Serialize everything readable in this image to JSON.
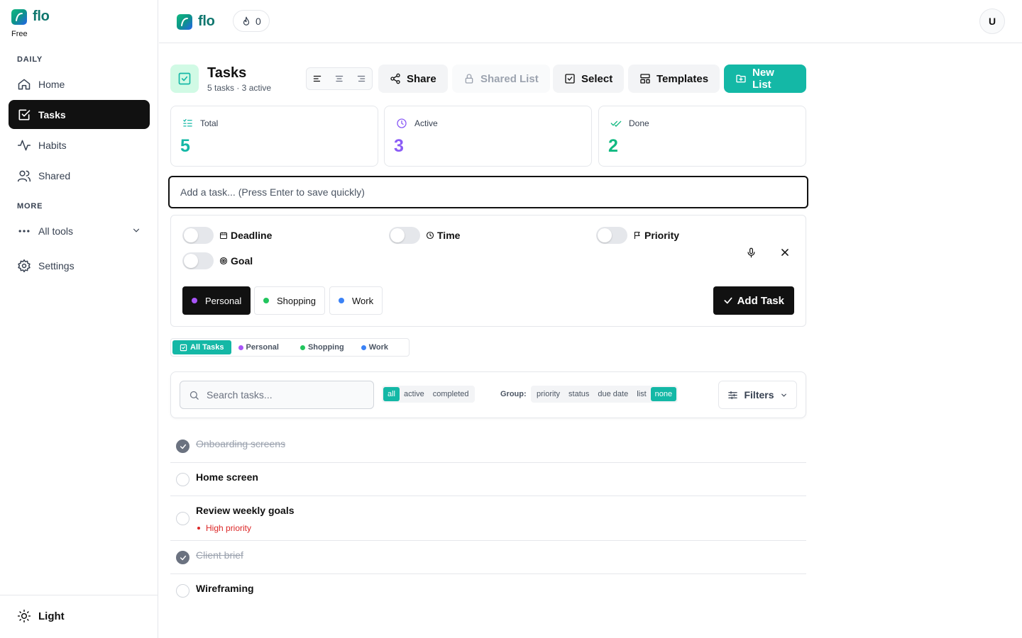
{
  "app": {
    "name": "flo",
    "plan": "Free"
  },
  "sidebar": {
    "section_daily": "DAILY",
    "section_more": "MORE",
    "items": [
      {
        "label": "Home",
        "icon": "home-icon"
      },
      {
        "label": "Tasks",
        "icon": "check-square-icon",
        "active": true
      },
      {
        "label": "Habits",
        "icon": "activity-icon"
      },
      {
        "label": "Shared",
        "icon": "users-icon"
      }
    ],
    "more_items": [
      {
        "label": "All tools",
        "icon": "more-horizontal-icon"
      },
      {
        "label": "Settings",
        "icon": "gear-icon"
      }
    ],
    "theme_label": "Light"
  },
  "topbar": {
    "streak_count": "0",
    "avatar_initial": "U"
  },
  "header": {
    "title": "Tasks",
    "subtitle": "5 tasks · 3 active",
    "buttons": {
      "share": "Share",
      "shared_list": "Shared List",
      "select": "Select",
      "templates": "Templates",
      "new_list": "New List"
    }
  },
  "stats": {
    "total": {
      "label": "Total",
      "value": "5",
      "color": "#14b8a6"
    },
    "active": {
      "label": "Active",
      "value": "3",
      "color": "#8b5cf6"
    },
    "done": {
      "label": "Done",
      "value": "2",
      "color": "#10b981"
    }
  },
  "add_task": {
    "placeholder": "Add a task... (Press Enter to save quickly)",
    "options": {
      "deadline": "Deadline",
      "time": "Time",
      "priority": "Priority",
      "goal": "Goal"
    },
    "lists": [
      {
        "label": "Personal",
        "color": "#a855f7",
        "active": true
      },
      {
        "label": "Shopping",
        "color": "#22c55e"
      },
      {
        "label": "Work",
        "color": "#3b82f6"
      }
    ],
    "submit": "Add Task"
  },
  "list_tabs": [
    {
      "label": "All Tasks",
      "active": true
    },
    {
      "label": "Personal",
      "color": "#a855f7"
    },
    {
      "label": "Shopping",
      "color": "#22c55e"
    },
    {
      "label": "Work",
      "color": "#3b82f6"
    }
  ],
  "filters": {
    "search_placeholder": "Search tasks...",
    "status": [
      "all",
      "active",
      "completed"
    ],
    "status_selected": "all",
    "group_label": "Group:",
    "group": [
      "priority",
      "status",
      "due date",
      "list",
      "none"
    ],
    "group_selected": "none",
    "filters_button": "Filters"
  },
  "tasks": [
    {
      "title": "Onboarding screens",
      "done": true
    },
    {
      "title": "Home screen",
      "done": false
    },
    {
      "title": "Review weekly goals",
      "done": false,
      "meta": "High priority"
    },
    {
      "title": "Client brief",
      "done": true
    },
    {
      "title": "Wireframing",
      "done": false
    }
  ],
  "colors": {
    "accent": "#14b8a6",
    "dark": "#111111",
    "danger": "#dc2626"
  }
}
